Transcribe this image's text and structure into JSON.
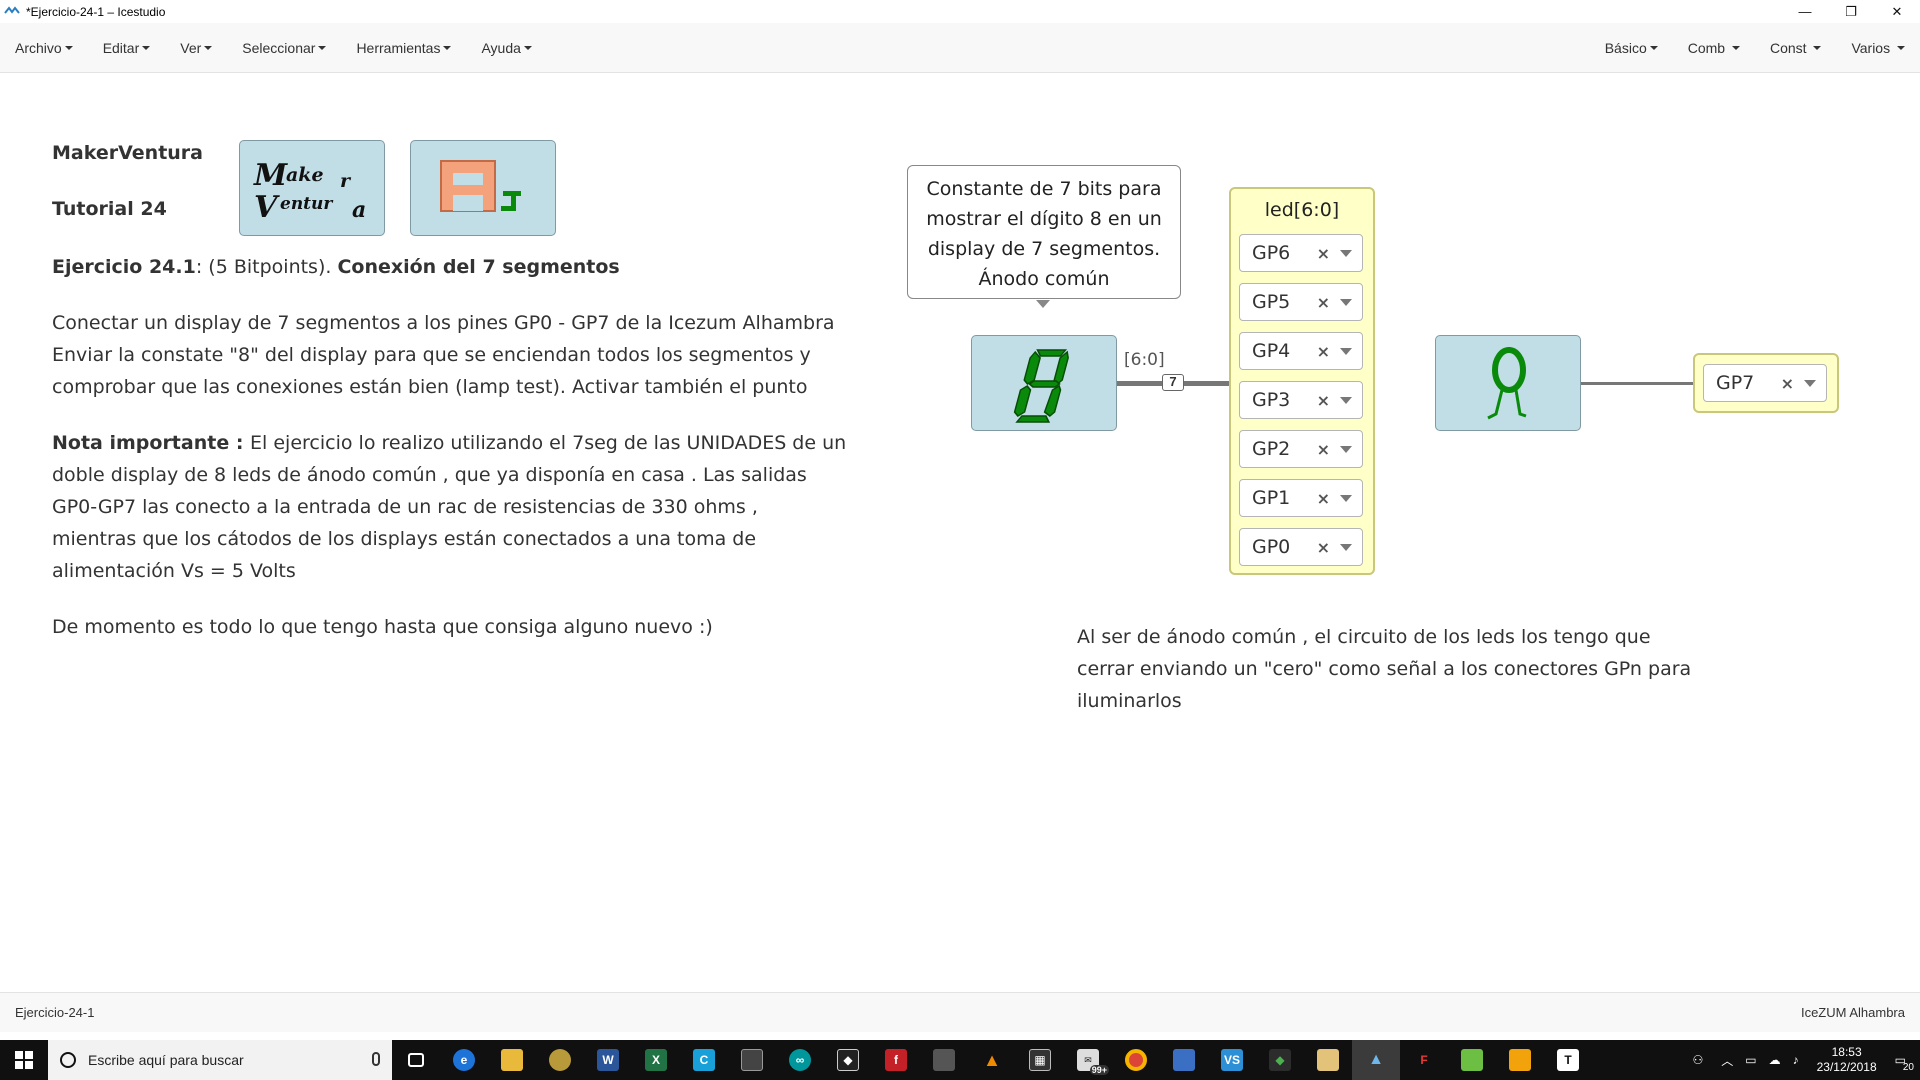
{
  "window": {
    "title": "*Ejercicio-24-1 – Icestudio"
  },
  "menu": {
    "left": [
      "Archivo",
      "Editar",
      "Ver",
      "Seleccionar",
      "Herramientas",
      "Ayuda"
    ],
    "right": [
      "Básico",
      "Comb",
      "Const",
      "Varios"
    ]
  },
  "canvas": {
    "header_line1": "MakerVentura",
    "header_line2": "Tutorial 24",
    "logo1_text": "Maker Ventura",
    "exercise_title_bold": "Ejercicio 24.1",
    "exercise_title_mid": ": (5 Bitpoints). ",
    "exercise_title_bold2": "Conexión del 7 segmentos",
    "para1_line1": "Conectar un display de 7 segmentos a los pines GP0 - GP7 de la Icezum Alhambra",
    "para1_line2": "Enviar la constate \"8\" del display para que se enciendan todos los segmentos y",
    "para1_line3": "comprobar que las conexiones están bien (lamp test). Activar también el punto",
    "note_bold": "Nota importante : ",
    "note_line1": "El ejercicio lo realizo utilizando el 7seg de las UNIDADES de un",
    "note_line2": "doble display de 8 leds de ánodo común , que ya disponía en casa . Las salidas",
    "note_line3": "GP0-GP7 las conecto a la entrada de un rac de resistencias de 330 ohms ,",
    "note_line4": "mientras que los cátodos de los displays están conectados a una toma de",
    "note_line5": "alimentación Vs = 5 Volts",
    "para3": "De momento es todo lo que tengo hasta que consiga alguno nuevo :)",
    "info_comment_lines": [
      "Constante de 7 bits para",
      "mostrar el dígito 8 en un",
      "display de 7 segmentos.",
      "Ánodo común"
    ],
    "bus_label": "[6:0]",
    "bus_size": "7",
    "output_title": "led[6:0]",
    "output_pins": [
      "GP6",
      "GP5",
      "GP4",
      "GP3",
      "GP2",
      "GP1",
      "GP0"
    ],
    "single_pin": "GP7",
    "pin_clear": "×",
    "right_comment_line1": "Al ser de ánodo común , el circuito de los leds los tengo que",
    "right_comment_line2": "cerrar enviando un \"cero\" como señal a los conectores GPn para",
    "right_comment_line3": "iluminarlos"
  },
  "statusbar": {
    "left": "Ejercicio-24-1",
    "right": "IceZUM Alhambra"
  },
  "taskbar": {
    "search_placeholder": "Escribe aquí para buscar",
    "time": "18:53",
    "date": "23/12/2018",
    "notifications": "20",
    "mail_badge": "99+"
  },
  "colors": {
    "block_fill": "#c1dde6",
    "io_fill": "#ffffc8",
    "seg_green": "#0a8a0a",
    "taskbar": "#101010"
  }
}
